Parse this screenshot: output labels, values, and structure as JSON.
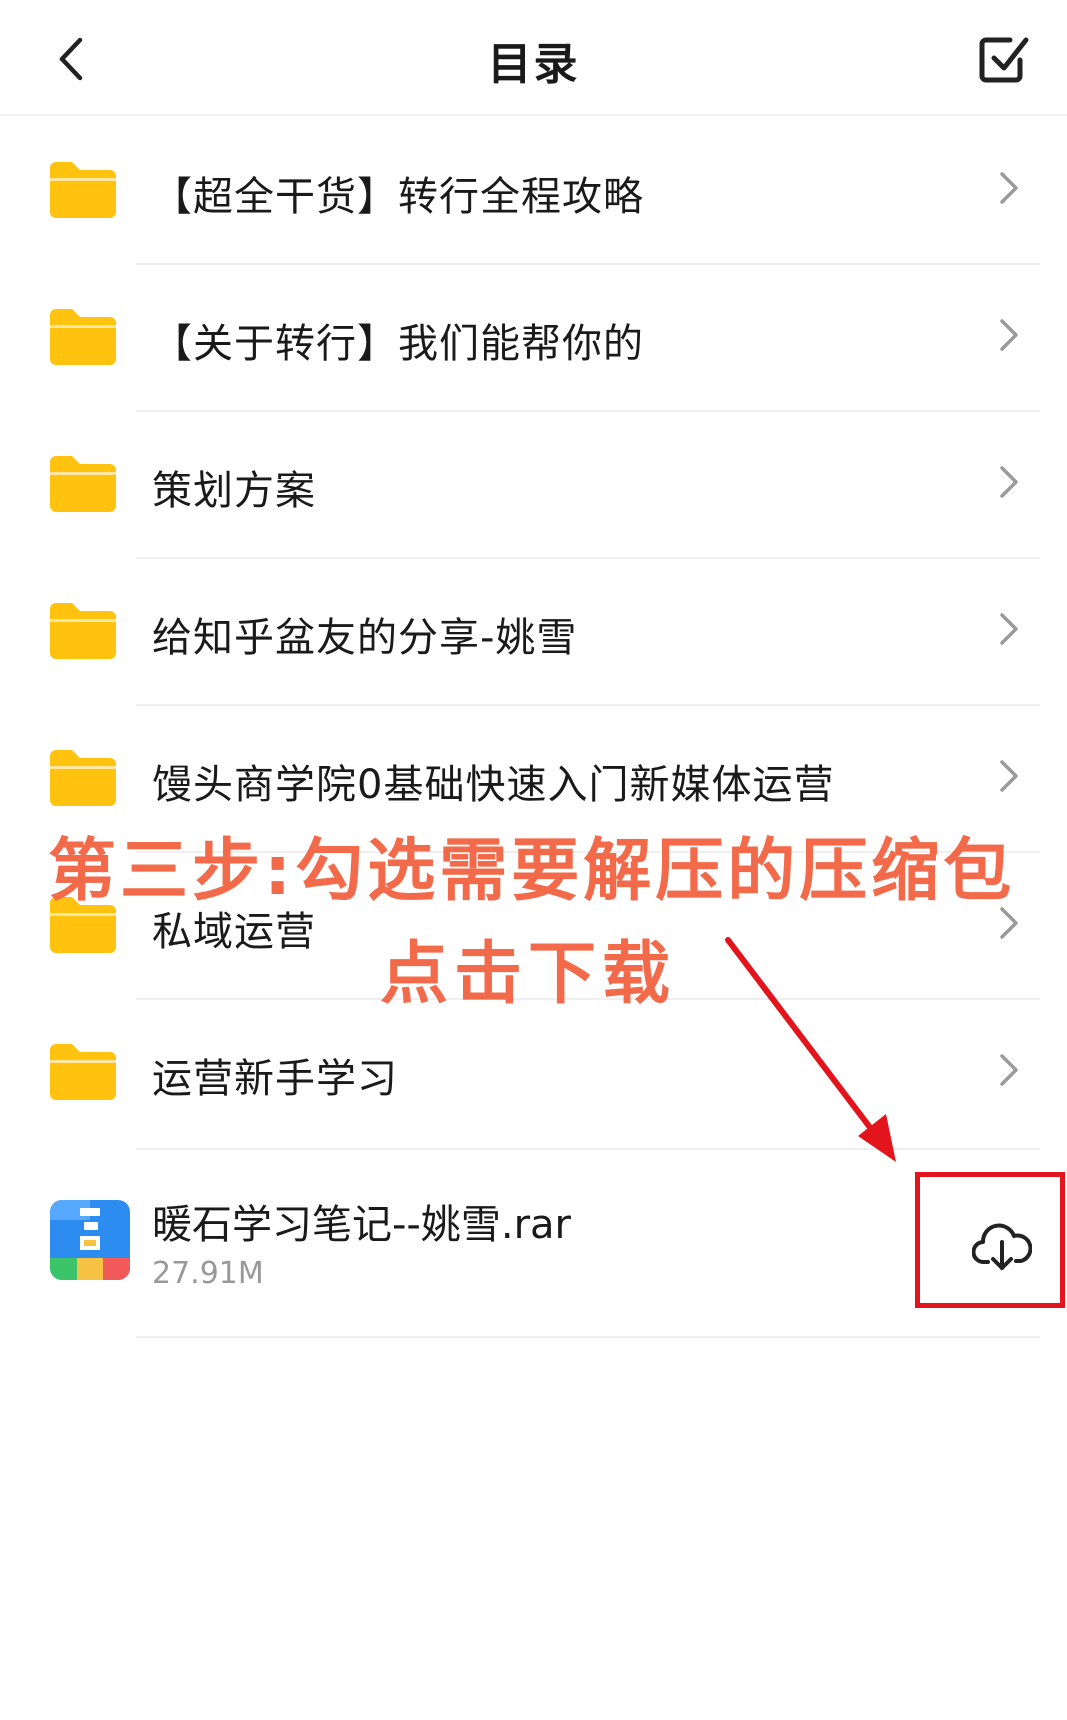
{
  "header": {
    "title": "目录"
  },
  "folders": [
    {
      "name": "【超全干货】转行全程攻略"
    },
    {
      "name": "【关于转行】我们能帮你的"
    },
    {
      "name": "策划方案"
    },
    {
      "name": "给知乎盆友的分享-姚雪"
    },
    {
      "name": "馒头商学院0基础快速入门新媒体运营"
    },
    {
      "name": "私域运营"
    },
    {
      "name": "运营新手学习"
    }
  ],
  "file": {
    "name": "暖石学习笔记--姚雪.rar",
    "size": "27.91M",
    "icon": "rar-archive-icon"
  },
  "annotation": {
    "line1": "第三步:勾选需要解压的压缩包",
    "line2": "点击下载"
  },
  "colors": {
    "folder": "#FFC20E",
    "annotation": "#F26A4A",
    "highlight": "#E3141C"
  }
}
